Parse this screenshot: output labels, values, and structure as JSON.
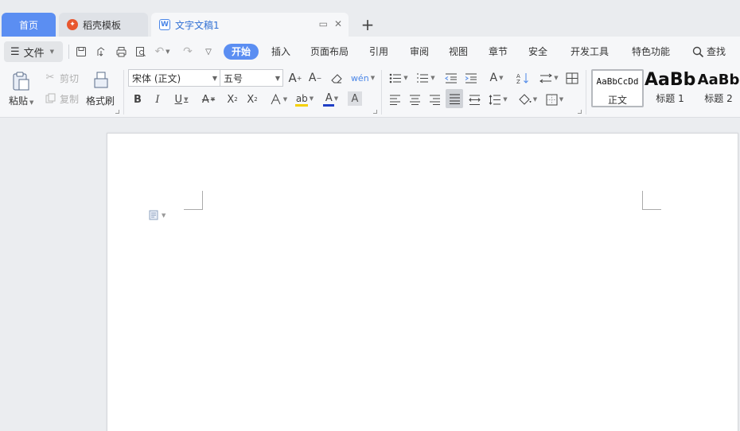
{
  "tabs": {
    "home": "首页",
    "docer": "稻壳模板",
    "doc": "文字文稿1",
    "new_tab": "+"
  },
  "menu": {
    "file": "文件",
    "tabs": [
      "开始",
      "插入",
      "页面布局",
      "引用",
      "审阅",
      "视图",
      "章节",
      "安全",
      "开发工具",
      "特色功能"
    ],
    "active_tab": "开始",
    "search": "查找"
  },
  "ribbon": {
    "paste": "粘贴",
    "cut": "剪切",
    "copy": "复制",
    "format_painter": "格式刷",
    "font_name": "宋体 (正文)",
    "font_size": "五号",
    "styles": [
      {
        "preview": "AaBbCcDd",
        "name": "正文"
      },
      {
        "preview": "AaBb",
        "name": "标题 1"
      },
      {
        "preview": "AaBb",
        "name": "标题 2"
      }
    ]
  },
  "colors": {
    "accent": "#5b8ef2",
    "highlight": "#f5d000",
    "font_color": "#1f3fc6"
  }
}
